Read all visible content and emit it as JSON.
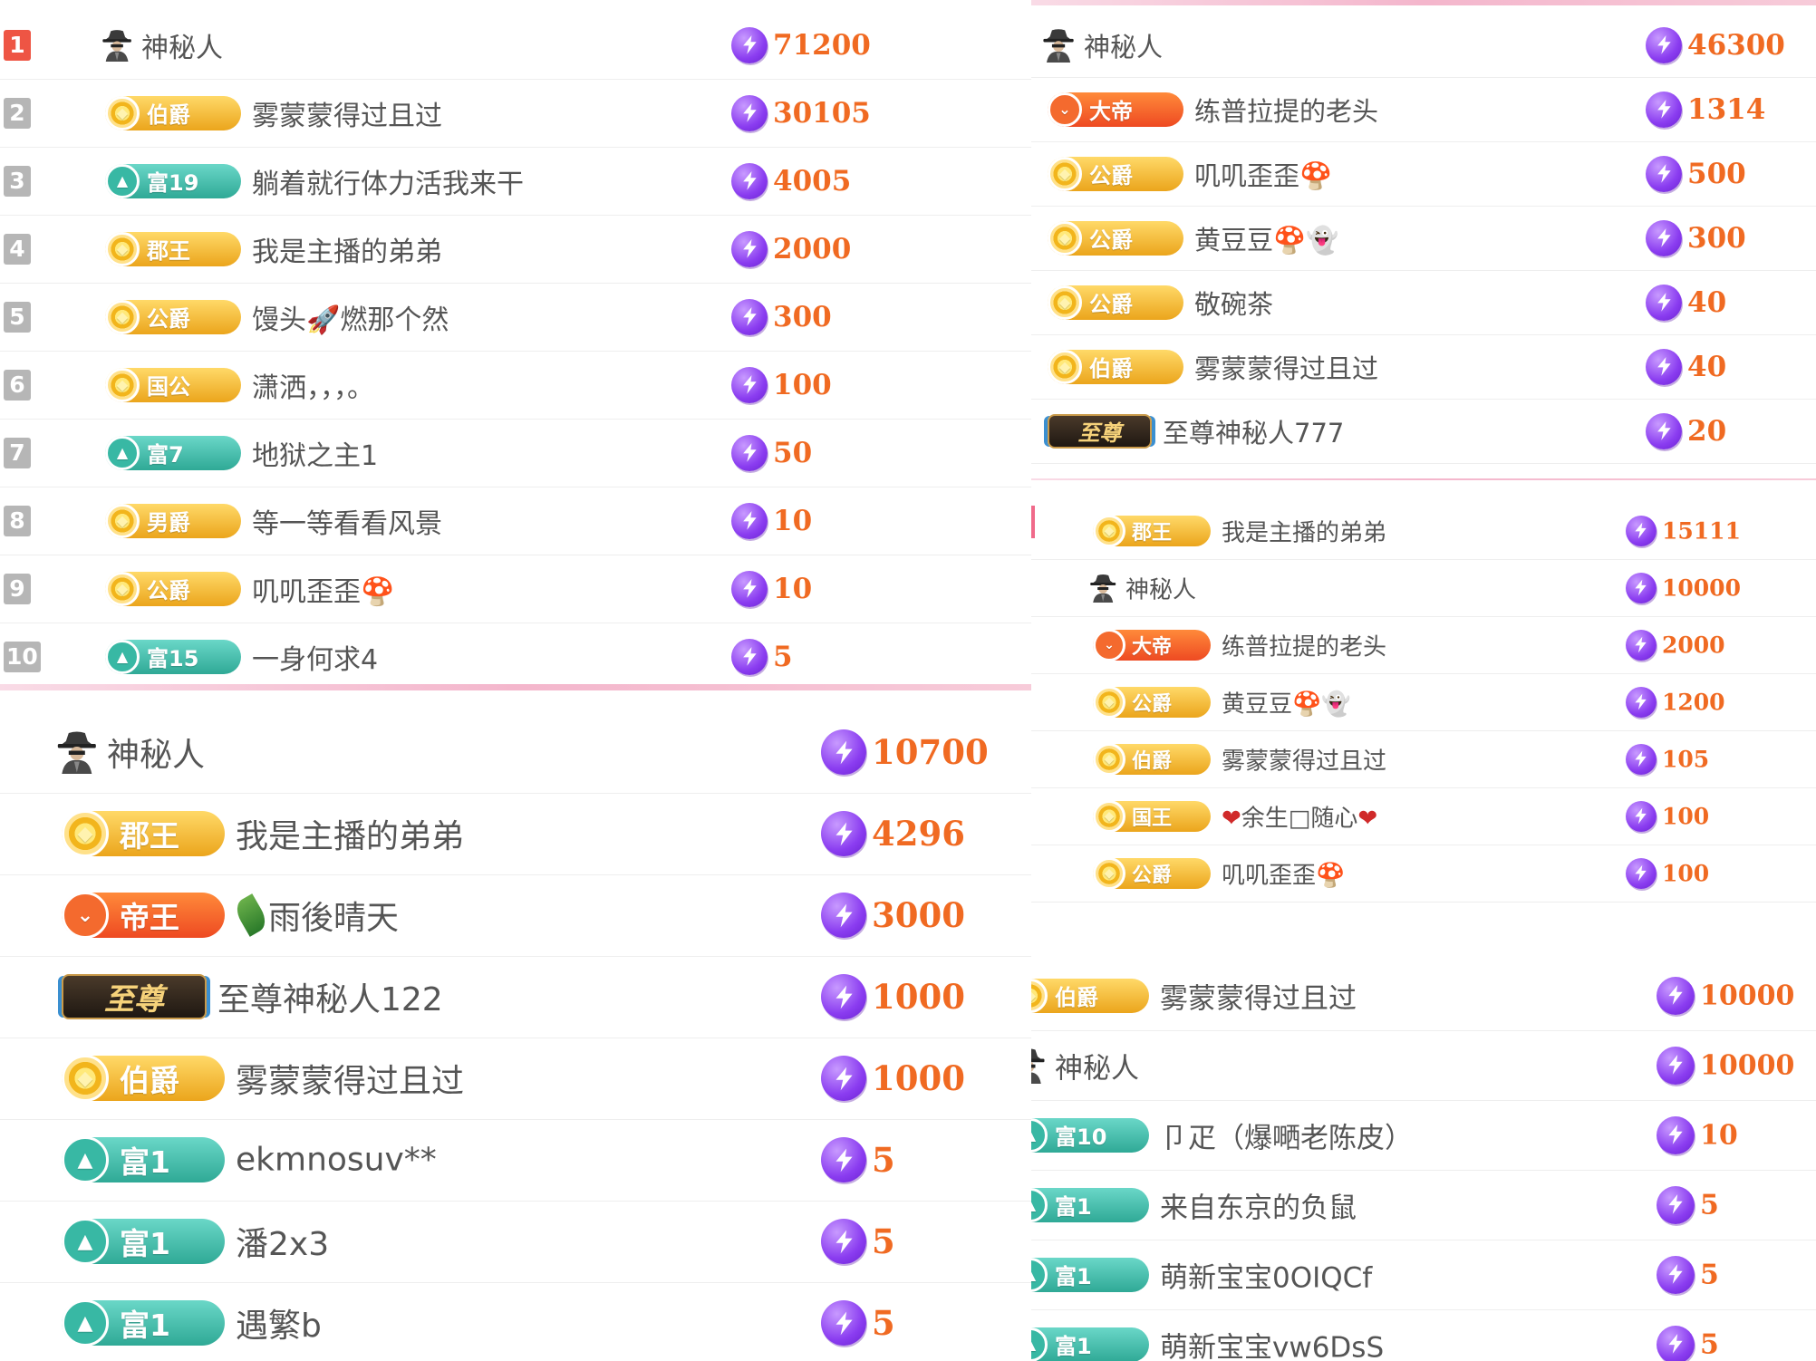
{
  "colors": {
    "score": "#f06a22",
    "bolt": "#8a3cf0",
    "rank_first": "#ee5544",
    "rank_other": "#b6b6b6",
    "badge_gold": "#f2b51c",
    "badge_teal": "#38b8a4",
    "badge_orange": "#f46a2e",
    "badge_dark": "#2a2018",
    "divider": "#f4b6cc"
  },
  "icons": {
    "mystery_user": "spy-avatar-icon",
    "score": "lightning-bolt-icon",
    "mushroom": "mushroom-icon",
    "rocket": "rocket-icon",
    "ghost": "ghost-icon",
    "leaf": "leaf-icon",
    "heart": "heart-icon"
  },
  "panel_a": {
    "rows": [
      {
        "rank": "1",
        "badge": "",
        "name": "神秘人",
        "score": "71200"
      },
      {
        "rank": "2",
        "badge": "伯爵",
        "name": "雾蒙蒙得过且过",
        "score": "30105"
      },
      {
        "rank": "3",
        "badge": "富19",
        "name": "躺着就行体力活我来干",
        "score": "4005"
      },
      {
        "rank": "4",
        "badge": "郡王",
        "name": "我是主播的弟弟",
        "score": "2000"
      },
      {
        "rank": "5",
        "badge": "公爵",
        "name": "馒头🚀燃那个然",
        "score": "300"
      },
      {
        "rank": "6",
        "badge": "国公",
        "name": "潇洒，，，。",
        "score": "100"
      },
      {
        "rank": "7",
        "badge": "富7",
        "name": "地狱之主1",
        "score": "50"
      },
      {
        "rank": "8",
        "badge": "男爵",
        "name": "等一等看看风景",
        "score": "10"
      },
      {
        "rank": "9",
        "badge": "公爵",
        "name": "叽叽歪歪🍄",
        "score": "10"
      },
      {
        "rank": "10",
        "badge": "富15",
        "name": "一身何求4",
        "score": "5"
      }
    ]
  },
  "panel_b": {
    "rows": [
      {
        "badge": "",
        "name": "神秘人",
        "score": "10700"
      },
      {
        "badge": "郡王",
        "name": "我是主播的弟弟",
        "score": "4296"
      },
      {
        "badge": "帝王",
        "name": "雨後晴天",
        "score": "3000"
      },
      {
        "badge": "至尊",
        "name": "至尊神秘人122",
        "score": "1000"
      },
      {
        "badge": "伯爵",
        "name": "雾蒙蒙得过且过",
        "score": "1000"
      },
      {
        "badge": "富1",
        "name": "ekmnosuv**",
        "score": "5"
      },
      {
        "badge": "富1",
        "name": "潘2x3",
        "score": "5"
      },
      {
        "badge": "富1",
        "name": "遇繁b",
        "score": "5"
      }
    ]
  },
  "panel_c": {
    "rows": [
      {
        "badge": "",
        "name": "神秘人",
        "score": "46300"
      },
      {
        "badge": "大帝",
        "name": "练普拉提的老头",
        "score": "1314"
      },
      {
        "badge": "公爵",
        "name": "叽叽歪歪🍄",
        "score": "500"
      },
      {
        "badge": "公爵",
        "name": "黄豆豆🍄👻",
        "score": "300"
      },
      {
        "badge": "公爵",
        "name": "敬碗茶",
        "score": "40"
      },
      {
        "badge": "伯爵",
        "name": "雾蒙蒙得过且过",
        "score": "40"
      },
      {
        "badge": "至尊",
        "name": "至尊神秘人777",
        "score": "20"
      }
    ]
  },
  "panel_d": {
    "rows": [
      {
        "badge": "郡王",
        "name": "我是主播的弟弟",
        "score": "15111"
      },
      {
        "badge": "",
        "name": "神秘人",
        "score": "10000"
      },
      {
        "badge": "大帝",
        "name": "练普拉提的老头",
        "score": "2000"
      },
      {
        "badge": "公爵",
        "name": "黄豆豆🍄👻",
        "score": "1200"
      },
      {
        "badge": "伯爵",
        "name": "雾蒙蒙得过且过",
        "score": "105"
      },
      {
        "badge": "国王",
        "name": "❤余生□随心❤",
        "score": "100"
      },
      {
        "badge": "公爵",
        "name": "叽叽歪歪🍄",
        "score": "100"
      }
    ]
  },
  "panel_e": {
    "rows": [
      {
        "badge": "伯爵",
        "name": "雾蒙蒙得过且过",
        "score": "10000"
      },
      {
        "badge": "",
        "name": "神秘人",
        "score": "10000"
      },
      {
        "badge": "富10",
        "name": "卩疋（爆嗮老陈皮）",
        "score": "10"
      },
      {
        "badge": "富1",
        "name": "来自东京的负鼠",
        "score": "5"
      },
      {
        "badge": "富1",
        "name": "萌新宝宝0OIQCf",
        "score": "5"
      },
      {
        "badge": "富1",
        "name": "萌新宝宝vw6DsS",
        "score": "5"
      }
    ]
  }
}
